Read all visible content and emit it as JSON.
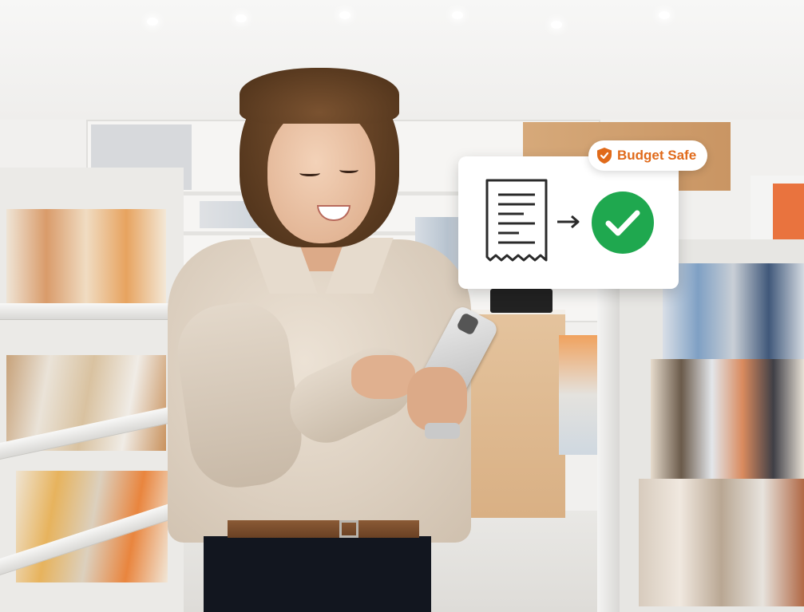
{
  "overlay": {
    "badge": {
      "label": "Budget Safe",
      "icon": "shield-icon"
    },
    "receipt_icon": "receipt-icon",
    "arrow_icon": "arrow-right-icon",
    "check_icon": "checkmark-circle-icon"
  },
  "colors": {
    "accent": "#e06a1a",
    "success": "#1fa84f",
    "card_bg": "#ffffff"
  }
}
